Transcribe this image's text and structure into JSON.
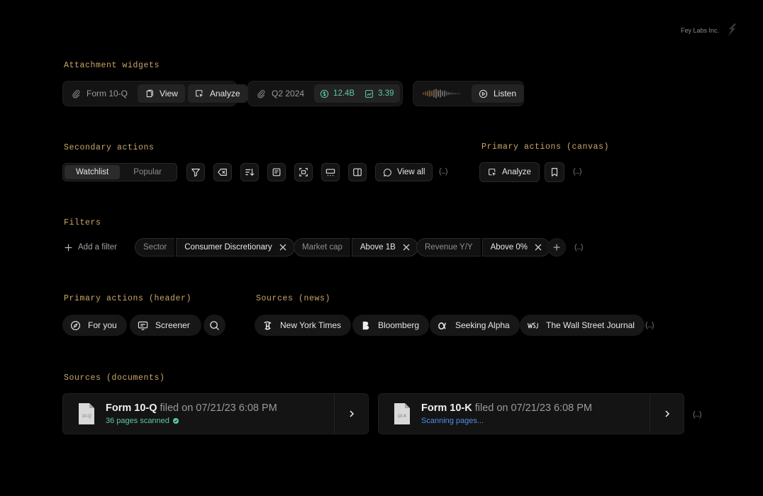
{
  "brand": {
    "name": "Fey Labs Inc."
  },
  "sections": {
    "attachment": "Attachment widgets",
    "secondary": "Secondary actions",
    "primary_canvas": "Primary actions (canvas)",
    "filters": "Filters",
    "primary_header": "Primary actions (header)",
    "sources_news": "Sources (news)",
    "sources_docs": "Sources (documents)"
  },
  "attachments": {
    "form": {
      "label": "Form 10-Q",
      "view": "View",
      "analyze": "Analyze"
    },
    "quarter": {
      "label": "Q2 2024",
      "metric1": "12.4B",
      "metric2": "3.39"
    },
    "audio": {
      "listen": "Listen"
    }
  },
  "secondary": {
    "tabs": [
      "Watchlist",
      "Popular"
    ],
    "active_tab": "Watchlist",
    "view_all": "View all",
    "more": "(...)"
  },
  "primary_canvas": {
    "analyze": "Analyze",
    "more": "(...)"
  },
  "filters": {
    "add": "Add a filter",
    "items": [
      {
        "label": "Sector",
        "value": "Consumer Discretionary"
      },
      {
        "label": "Market cap",
        "value": "Above 1B"
      },
      {
        "label": "Revenue Y/Y",
        "value": "Above 0%"
      }
    ],
    "more": "(...)"
  },
  "primary_header": {
    "for_you": "For you",
    "screener": "Screener"
  },
  "news_sources": {
    "items": [
      "New York Times",
      "Bloomberg",
      "Seeking Alpha",
      "The Wall Street Journal"
    ],
    "more": "(...)"
  },
  "documents": {
    "items": [
      {
        "title": "Form 10-Q",
        "sub": "filed on 07/21/23 6:08 PM",
        "status": "36 pages scanned",
        "icon_text": "10-Q",
        "status_color": "#5cc9a7"
      },
      {
        "title": "Form 10-K",
        "sub": "filed on 07/21/23 6:08 PM",
        "status": "Scanning pages...",
        "icon_text": "10-K",
        "status_color": "#4f8fe8"
      }
    ],
    "more": "(...)"
  },
  "colors": {
    "accent_gold": "#c9a86a",
    "positive": "#5cc9a7",
    "info": "#4f8fe8"
  }
}
